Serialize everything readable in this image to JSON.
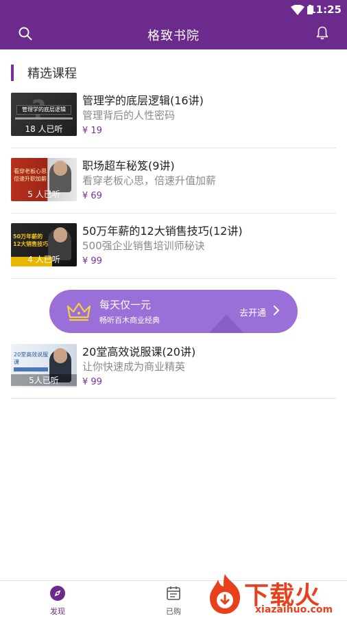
{
  "status": {
    "time": "11:25"
  },
  "header": {
    "title": "格致书院"
  },
  "section": {
    "title": "精选课程"
  },
  "courses": [
    {
      "thumb_text": "管理学的底层逻辑 —— 人性管理",
      "listeners": "18 人已听",
      "title": "管理学的底层逻辑(16讲)",
      "subtitle": "管理背后的人性密码",
      "price": "¥ 19"
    },
    {
      "thumb_text": "看穿老板心思 倍速升职加薪",
      "listeners": "5 人已听",
      "title": "职场超车秘笈(9讲)",
      "subtitle": "看穿老板心思，倍速升值加薪",
      "price": "¥ 69"
    },
    {
      "thumb_text": "50万年薪的12大销售技巧",
      "listeners": "4 人已听",
      "title": "50万年薪的12大销售技巧(12讲)",
      "subtitle": "500强企业销售培训师秘诀",
      "price": "¥ 99"
    },
    {
      "thumb_text": "20堂高效说服课",
      "listeners": "5人已听",
      "title": "20堂高效说服课(20讲)",
      "subtitle": "让你快速成为商业精英",
      "price": "¥ 99"
    }
  ],
  "promo": {
    "title": "每天仅一元",
    "subtitle": "畅听百木商业经典",
    "cta": "去开通"
  },
  "tabs": [
    {
      "label": "发现",
      "icon": "compass-icon"
    },
    {
      "label": "已购",
      "icon": "calendar-icon"
    }
  ],
  "watermark": {
    "text": "下载火",
    "url": "xiazaihuo.com"
  },
  "colors": {
    "primary": "#6b2a8c",
    "accent": "#7a2f98",
    "promo": "#9b6fd8",
    "watermark": "#e8401c"
  }
}
